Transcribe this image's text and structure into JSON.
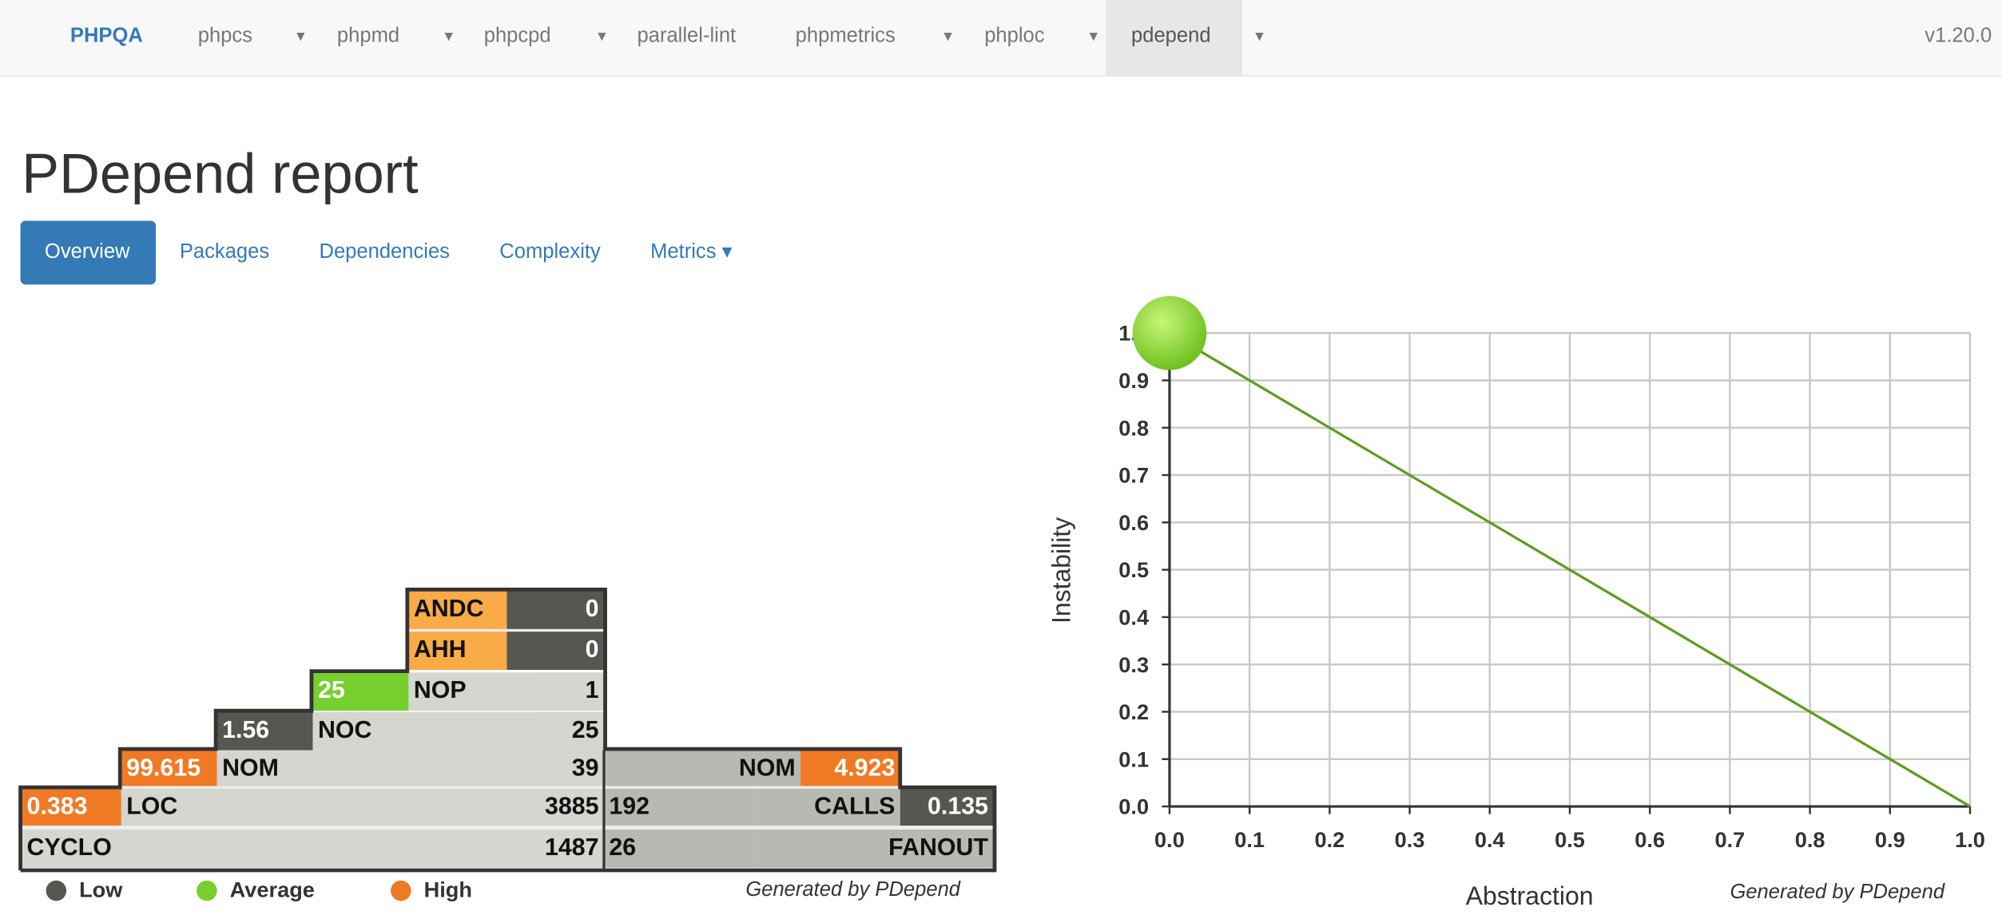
{
  "nav": {
    "brand": "PHPQA",
    "items": [
      {
        "label": "phpcs",
        "caret": true
      },
      {
        "label": "phpmd",
        "caret": true
      },
      {
        "label": "phpcpd",
        "caret": true
      },
      {
        "label": "parallel-lint",
        "caret": false
      },
      {
        "label": "phpmetrics",
        "caret": true
      },
      {
        "label": "phploc",
        "caret": true
      },
      {
        "label": "pdepend",
        "caret": true,
        "active": true
      }
    ],
    "version": "v1.20.0"
  },
  "page_title": "PDepend report",
  "tabs": [
    {
      "label": "Overview",
      "active": true
    },
    {
      "label": "Packages"
    },
    {
      "label": "Dependencies"
    },
    {
      "label": "Complexity"
    },
    {
      "label": "Metrics ▾"
    }
  ],
  "pyramid": {
    "andc": {
      "label": "ANDC",
      "value": "0"
    },
    "ahh": {
      "label": "AHH",
      "value": "0"
    },
    "nop": {
      "ratio": "25",
      "label": "NOP",
      "value": "1"
    },
    "noc": {
      "ratio": "1.56",
      "label": "NOC",
      "value": "25"
    },
    "nom": {
      "ratio": "99.615",
      "label": "NOM",
      "value": "39"
    },
    "loc": {
      "ratio": "0.383",
      "label": "LOC",
      "value": "3885"
    },
    "cyclo": {
      "label": "CYCLO",
      "value": "1487"
    },
    "nom_right": {
      "label": "NOM",
      "ratio": "4.923"
    },
    "calls": {
      "value": "192",
      "label": "CALLS",
      "ratio": "0.135"
    },
    "fanout": {
      "value": "26",
      "label": "FANOUT"
    },
    "legend": [
      {
        "label": "Low",
        "color": "#555750"
      },
      {
        "label": "Average",
        "color": "#77cf2f"
      },
      {
        "label": "High",
        "color": "#f07a24"
      }
    ],
    "generated": "Generated  by PDepend"
  },
  "chart_data": {
    "type": "scatter",
    "xlabel": "Abstraction",
    "ylabel": "Instability",
    "xlim": [
      0,
      1
    ],
    "ylim": [
      0,
      1
    ],
    "grid": true,
    "x_ticks": [
      "0.0",
      "0.1",
      "0.2",
      "0.3",
      "0.4",
      "0.5",
      "0.6",
      "0.7",
      "0.8",
      "0.9",
      "1.0"
    ],
    "y_ticks": [
      "0.0",
      "0.1",
      "0.2",
      "0.3",
      "0.4",
      "0.5",
      "0.6",
      "0.7",
      "0.8",
      "0.9",
      "1.0"
    ],
    "points": [
      {
        "x": 0,
        "y": 1
      }
    ],
    "main_sequence": [
      [
        0,
        1
      ],
      [
        1,
        0
      ]
    ],
    "colors": {
      "point": "#8fdc32",
      "line": "#5a9e1a",
      "grid": "#c8c8c8"
    },
    "generated": "Generated by PDepend"
  }
}
